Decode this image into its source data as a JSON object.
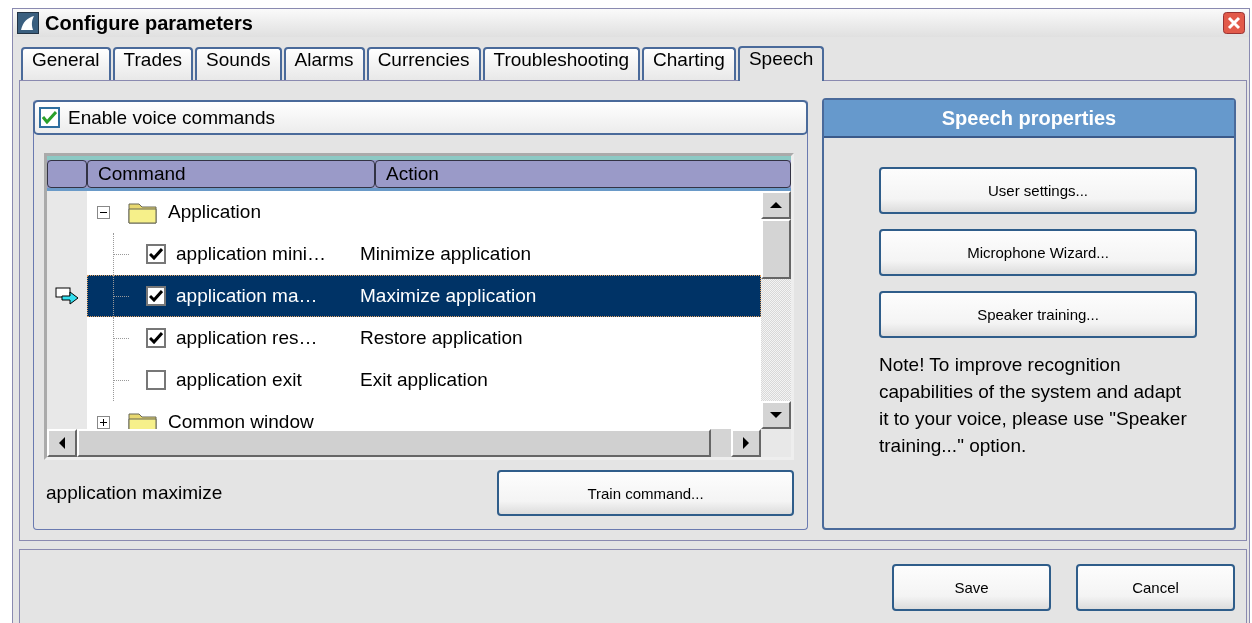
{
  "window": {
    "title": "Configure parameters"
  },
  "tabs": [
    {
      "label": "General",
      "selected": false
    },
    {
      "label": "Trades",
      "selected": false
    },
    {
      "label": "Sounds",
      "selected": false
    },
    {
      "label": "Alarms",
      "selected": false
    },
    {
      "label": "Currencies",
      "selected": false
    },
    {
      "label": "Troubleshooting",
      "selected": false
    },
    {
      "label": "Charting",
      "selected": false
    },
    {
      "label": "Speech",
      "selected": true
    }
  ],
  "enable_voice_commands": {
    "label": "Enable voice commands",
    "checked": true
  },
  "commands_table": {
    "columns": [
      "Command",
      "Action"
    ],
    "groups": [
      {
        "name": "Application",
        "expanded": true,
        "selected": false,
        "children": [
          {
            "command": "application mini…",
            "action": "Minimize application",
            "checked": true,
            "selected": false
          },
          {
            "command": "application ma…",
            "action": "Maximize application",
            "checked": true,
            "selected": true
          },
          {
            "command": "application res…",
            "action": "Restore application",
            "checked": true,
            "selected": false
          },
          {
            "command": "application exit",
            "action": "Exit application",
            "checked": false,
            "selected": false
          }
        ]
      },
      {
        "name": "Common window",
        "expanded": false,
        "selected": false
      }
    ]
  },
  "selected_command": "application maximize",
  "train_button": "Train command...",
  "speech_properties": {
    "title": "Speech properties",
    "buttons": [
      "User settings...",
      "Microphone Wizard...",
      "Speaker training..."
    ],
    "note": "Note! To improve recognition capabilities of the system and adapt it to your voice, please use \"Speaker training...\" option."
  },
  "footer_buttons": [
    "Save",
    "Cancel"
  ]
}
